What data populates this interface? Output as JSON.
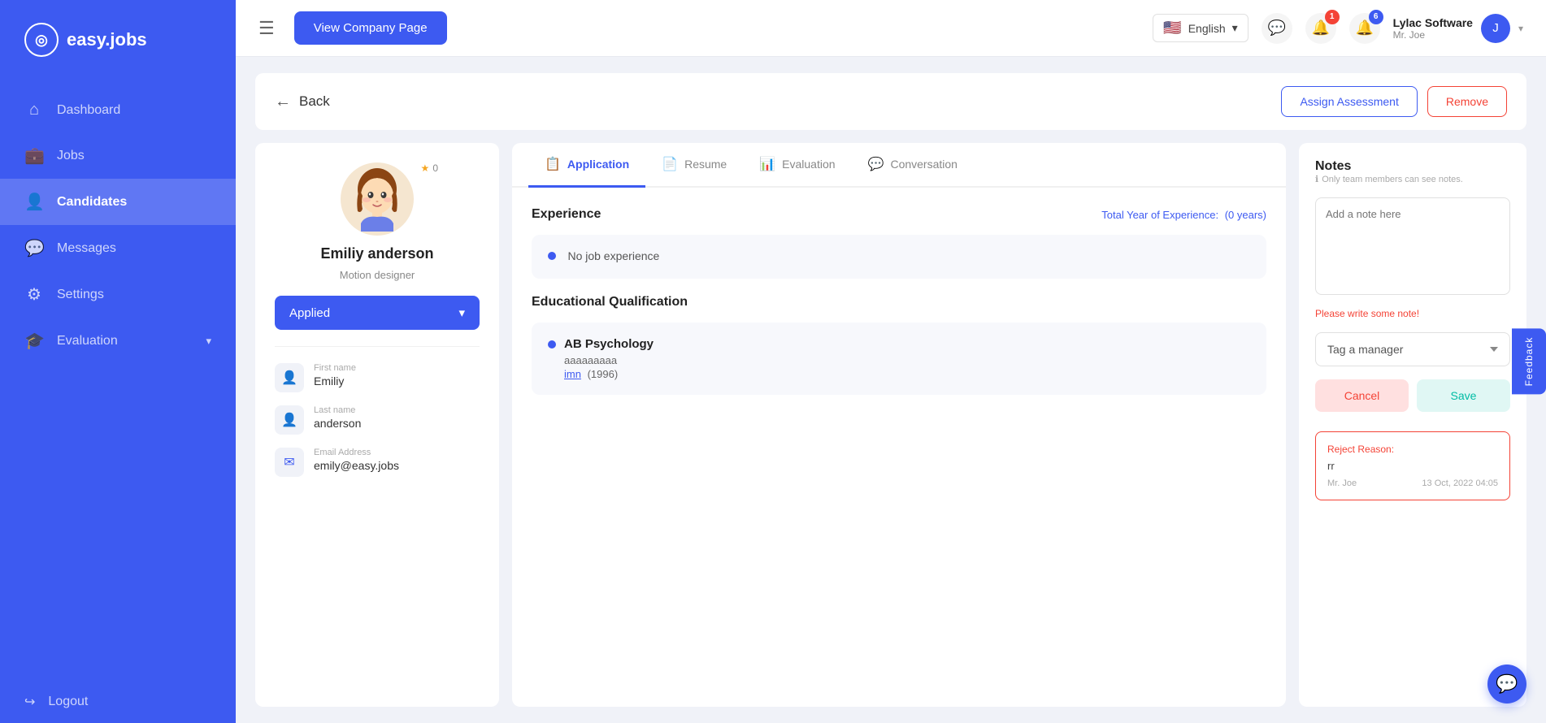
{
  "sidebar": {
    "logo": {
      "text": "easy.jobs",
      "icon": "◎"
    },
    "items": [
      {
        "id": "dashboard",
        "label": "Dashboard",
        "icon": "⌂",
        "active": false
      },
      {
        "id": "jobs",
        "label": "Jobs",
        "icon": "💼",
        "active": false
      },
      {
        "id": "candidates",
        "label": "Candidates",
        "icon": "👤",
        "active": true
      },
      {
        "id": "messages",
        "label": "Messages",
        "icon": "💬",
        "active": false
      },
      {
        "id": "settings",
        "label": "Settings",
        "icon": "⚙",
        "active": false
      },
      {
        "id": "evaluation",
        "label": "Evaluation",
        "icon": "🎓",
        "active": false
      }
    ],
    "logout_label": "Logout"
  },
  "topbar": {
    "view_company_btn": "View Company Page",
    "language": "English",
    "flag": "🇺🇸",
    "chat_badge": "",
    "notification_badge": "1",
    "alert_badge": "6",
    "company_name": "Lylac Software",
    "user_name": "Mr. Joe"
  },
  "back_btn": "Back",
  "actions": {
    "assign_assessment": "Assign Assessment",
    "remove": "Remove"
  },
  "candidate": {
    "name": "Emiliy anderson",
    "role": "Motion designer",
    "stars": "0",
    "status": "Applied",
    "first_name_label": "First name",
    "first_name": "Emiliy",
    "last_name_label": "Last name",
    "last_name": "anderson",
    "email_label": "Email Address",
    "email": "emily@easy.jobs"
  },
  "tabs": [
    {
      "id": "application",
      "label": "Application",
      "icon": "📋",
      "active": true
    },
    {
      "id": "resume",
      "label": "Resume",
      "icon": "📄",
      "active": false
    },
    {
      "id": "evaluation",
      "label": "Evaluation",
      "icon": "📊",
      "active": false
    },
    {
      "id": "conversation",
      "label": "Conversation",
      "icon": "💬",
      "active": false
    }
  ],
  "experience": {
    "section_title": "Experience",
    "total_label": "Total Year of Experience:",
    "total_value": "(0 years)",
    "no_experience": "No job experience"
  },
  "education": {
    "section_title": "Educational Qualification",
    "degree": "AB Psychology",
    "institution": "aaaaaaaaa",
    "link": "imn",
    "year": "(1996)"
  },
  "notes": {
    "title": "Notes",
    "subtitle": "Only team members can see notes.",
    "placeholder": "Add a note here",
    "error": "Please write some note!",
    "tag_placeholder": "Tag a manager",
    "cancel_label": "Cancel",
    "save_label": "Save"
  },
  "reject": {
    "label": "Reject Reason:",
    "reason": "rr",
    "user": "Mr. Joe",
    "date": "13 Oct, 2022 04:05"
  },
  "feedback_label": "Feedback"
}
